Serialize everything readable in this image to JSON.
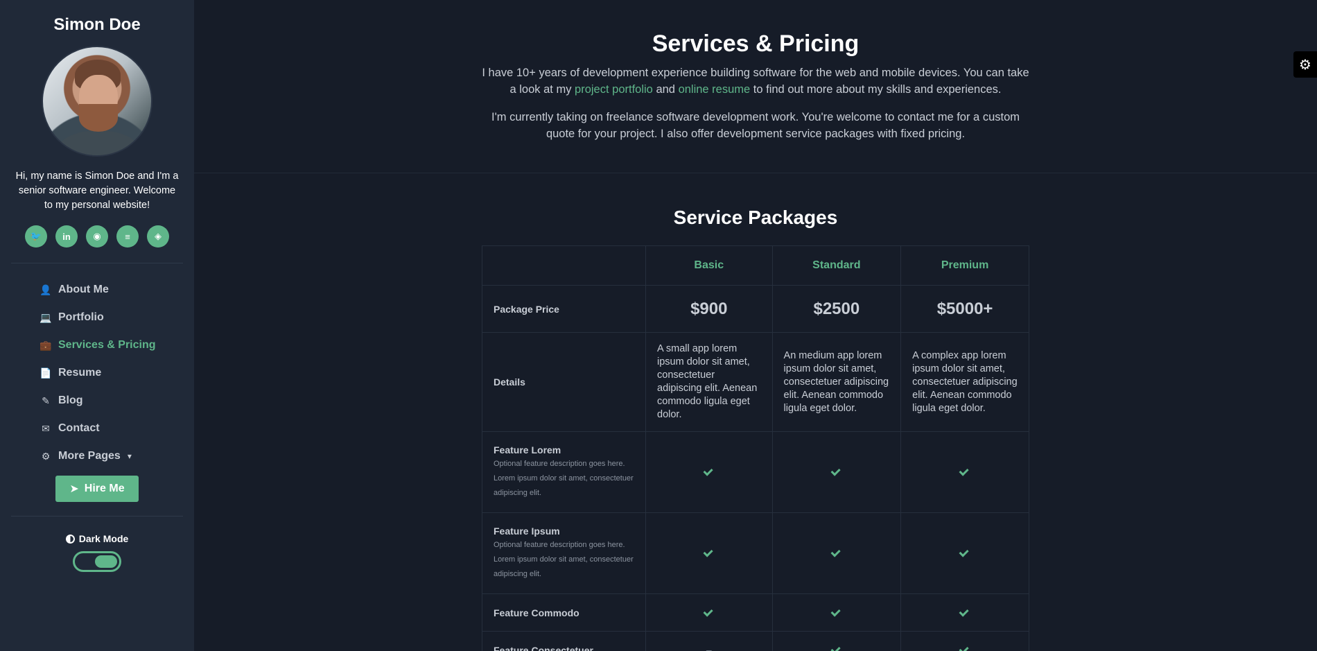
{
  "sidebar": {
    "name": "Simon Doe",
    "bio": "Hi, my name is Simon Doe and I'm a senior software engineer. Welcome to my personal website!",
    "socials": [
      {
        "icon": "twitter-icon",
        "glyph": "🐦"
      },
      {
        "icon": "linkedin-icon",
        "glyph": "in"
      },
      {
        "icon": "github-icon",
        "glyph": "◉"
      },
      {
        "icon": "stack-overflow-icon",
        "glyph": "≡"
      },
      {
        "icon": "codepen-icon",
        "glyph": "◈"
      }
    ],
    "nav": [
      {
        "label": "About Me",
        "icon": "user-icon",
        "glyph": "👤",
        "active": false
      },
      {
        "label": "Portfolio",
        "icon": "laptop-code-icon",
        "glyph": "💻",
        "active": false
      },
      {
        "label": "Services & Pricing",
        "icon": "briefcase-icon",
        "glyph": "💼",
        "active": true
      },
      {
        "label": "Resume",
        "icon": "file-alt-icon",
        "glyph": "📄",
        "active": false
      },
      {
        "label": "Blog",
        "icon": "blog-icon",
        "glyph": "✎",
        "active": false
      },
      {
        "label": "Contact",
        "icon": "envelope-open-icon",
        "glyph": "✉",
        "active": false
      },
      {
        "label": "More Pages",
        "icon": "cogs-icon",
        "glyph": "⚙",
        "active": false,
        "dropdown": true
      }
    ],
    "hire_label": "Hire Me",
    "dark_mode_label": "Dark Mode",
    "dark_mode_on": true
  },
  "intro": {
    "title": "Services & Pricing",
    "p1_before": "I have 10+ years of development experience building software for the web and mobile devices. You can take a look at my ",
    "p1_link1": "project portfolio",
    "p1_mid": " and ",
    "p1_link2": "online resume",
    "p1_after": " to find out more about my skills and experiences.",
    "p2": "I'm currently taking on freelance software development work. You're welcome to contact me for a custom quote for your project. I also offer development service packages with fixed pricing."
  },
  "packages": {
    "title": "Service Packages",
    "columns": [
      "Basic",
      "Standard",
      "Premium"
    ],
    "price_label": "Package Price",
    "prices": [
      "$900",
      "$2500",
      "$5000+"
    ],
    "details_label": "Details",
    "details": [
      "A small app lorem ipsum dolor sit amet, consectetuer adipiscing elit. Aenean commodo ligula eget dolor.",
      "An medium app lorem ipsum dolor sit amet, consectetuer adipiscing elit. Aenean commodo ligula eget dolor.",
      "A complex app lorem ipsum dolor sit amet, consectetuer adipiscing elit. Aenean commodo ligula eget dolor."
    ],
    "features": [
      {
        "name": "Feature Lorem",
        "desc": "Optional feature description goes here. Lorem ipsum dolor sit amet, consectetuer adipiscing elit.",
        "marks": [
          "check",
          "check",
          "check"
        ]
      },
      {
        "name": "Feature Ipsum",
        "desc": "Optional feature description goes here. Lorem ipsum dolor sit amet, consectetuer adipiscing elit.",
        "marks": [
          "check",
          "check",
          "check"
        ]
      },
      {
        "name": "Feature Commodo",
        "desc": "",
        "marks": [
          "check",
          "check",
          "check"
        ]
      },
      {
        "name": "Feature Consectetuer",
        "desc": "",
        "marks": [
          "dash",
          "check",
          "check"
        ]
      }
    ]
  },
  "settings_icon": "gear-icon"
}
